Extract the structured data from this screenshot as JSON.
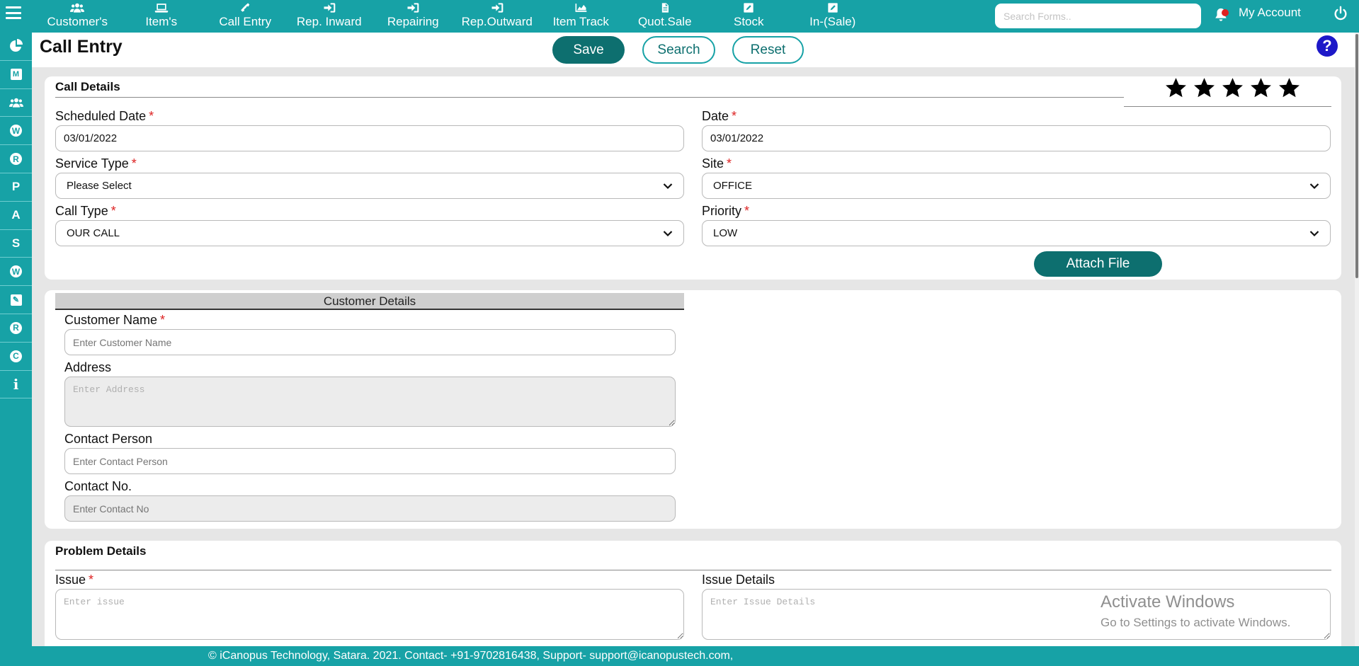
{
  "nav": {
    "items": [
      {
        "label": "Customer's",
        "icon": "users-icon"
      },
      {
        "label": "Item's",
        "icon": "laptop-icon"
      },
      {
        "label": "Call Entry",
        "icon": "phone-icon"
      },
      {
        "label": "Rep. Inward",
        "icon": "sign-in-icon"
      },
      {
        "label": "Repairing",
        "icon": "sign-in-icon"
      },
      {
        "label": "Rep.Outward",
        "icon": "sign-in-icon"
      },
      {
        "label": "Item Track",
        "icon": "area-chart-icon"
      },
      {
        "label": "Quot.Sale",
        "icon": "document-icon"
      },
      {
        "label": "Stock",
        "icon": "edit-icon"
      },
      {
        "label": "In-(Sale)",
        "icon": "edit-icon"
      }
    ],
    "search_placeholder": "Search Forms..",
    "account_label": "My Account"
  },
  "sidebar": {
    "items": [
      {
        "icon": "pie-chart-icon",
        "glyph": ""
      },
      {
        "icon": "m-square-icon",
        "glyph": "M"
      },
      {
        "icon": "users-icon",
        "glyph": ""
      },
      {
        "icon": "wordpress-icon",
        "glyph": "W"
      },
      {
        "icon": "r-circle-icon",
        "glyph": "R"
      },
      {
        "icon": "pinterest-icon",
        "glyph": "P"
      },
      {
        "icon": "a-letter-icon",
        "glyph": "A"
      },
      {
        "icon": "s-letter-icon",
        "glyph": "S"
      },
      {
        "icon": "wordpress-icon",
        "glyph": "W"
      },
      {
        "icon": "edit-square-icon",
        "glyph": "✎"
      },
      {
        "icon": "r-circle-icon",
        "glyph": "R"
      },
      {
        "icon": "c-circle-icon",
        "glyph": "C"
      },
      {
        "icon": "info-icon",
        "glyph": "i"
      }
    ]
  },
  "header": {
    "title": "Call Entry",
    "save_label": "Save",
    "search_label": "Search",
    "reset_label": "Reset",
    "help_glyph": "?"
  },
  "call_details": {
    "title": "Call Details",
    "rating": 5,
    "scheduled_date": {
      "label": "Scheduled Date",
      "required": "*",
      "value": "03/01/2022"
    },
    "date": {
      "label": "Date",
      "required": "*",
      "value": "03/01/2022"
    },
    "service_type": {
      "label": "Service Type",
      "required": "*",
      "value": "Please Select"
    },
    "site": {
      "label": "Site",
      "required": "*",
      "value": "OFFICE"
    },
    "call_type": {
      "label": "Call Type",
      "required": "*",
      "value": "OUR CALL"
    },
    "priority": {
      "label": "Priority",
      "required": "*",
      "value": "LOW"
    },
    "attach_label": "Attach File"
  },
  "customer_details": {
    "title": "Customer Details",
    "name": {
      "label": "Customer Name",
      "required": "*",
      "placeholder": "Enter Customer Name"
    },
    "address": {
      "label": "Address",
      "placeholder": "Enter Address"
    },
    "contact_person": {
      "label": "Contact Person",
      "placeholder": "Enter Contact Person"
    },
    "contact_no": {
      "label": "Contact No.",
      "placeholder": "Enter Contact No"
    }
  },
  "problem_details": {
    "title": "Problem Details",
    "issue": {
      "label": "Issue",
      "required": "*",
      "placeholder": "Enter issue"
    },
    "issue_details": {
      "label": "Issue Details",
      "placeholder": "Enter Issue Details"
    }
  },
  "watermark": {
    "line1": "Activate Windows",
    "line2": "Go to Settings to activate Windows."
  },
  "footer": {
    "text": "© iCanopus Technology, Satara. 2021. Contact- +91-9702816438, Support- support@icanopustech.com,"
  },
  "colors": {
    "brand": "#17a2a6",
    "button_dark": "#0d6f6f",
    "required": "#dd2222",
    "help": "#1d18c8"
  }
}
